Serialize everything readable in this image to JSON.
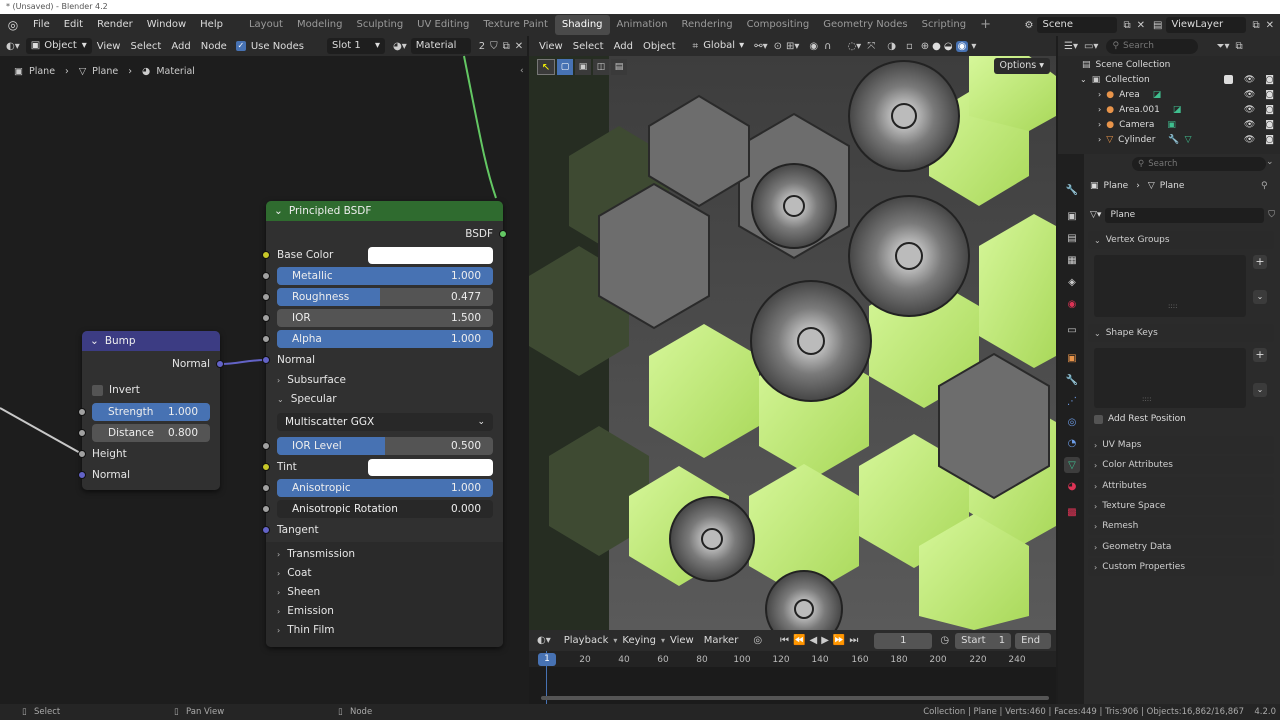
{
  "window_title": "* (Unsaved) - Blender 4.2",
  "menu": [
    "File",
    "Edit",
    "Render",
    "Window",
    "Help"
  ],
  "workspace_tabs": [
    {
      "label": "Layout",
      "active": false
    },
    {
      "label": "Modeling",
      "active": false
    },
    {
      "label": "Sculpting",
      "active": false
    },
    {
      "label": "UV Editing",
      "active": false
    },
    {
      "label": "Texture Paint",
      "active": false
    },
    {
      "label": "Shading",
      "active": true
    },
    {
      "label": "Animation",
      "active": false
    },
    {
      "label": "Rendering",
      "active": false
    },
    {
      "label": "Compositing",
      "active": false
    },
    {
      "label": "Geometry Nodes",
      "active": false
    },
    {
      "label": "Scripting",
      "active": false
    }
  ],
  "add_workspace": "+",
  "scene": {
    "label": "Scene",
    "view_layer": "ViewLayer"
  },
  "node_editor": {
    "mode": "Object",
    "menus": [
      "View",
      "Select",
      "Add",
      "Node"
    ],
    "use_nodes_label": "Use Nodes",
    "slot": "Slot 1",
    "material": "Material",
    "users": "2",
    "breadcrumb": [
      "Plane",
      "Plane",
      "Material"
    ]
  },
  "bump_node": {
    "title": "Bump",
    "output": "Normal",
    "invert_label": "Invert",
    "strength_label": "Strength",
    "strength_value": "1.000",
    "distance_label": "Distance",
    "distance_value": "0.800",
    "height_label": "Height",
    "normal_label": "Normal"
  },
  "bsdf_node": {
    "title": "Principled BSDF",
    "output": "BSDF",
    "base_color_label": "Base Color",
    "metallic": {
      "label": "Metallic",
      "value": "1.000",
      "fill": 1.0
    },
    "roughness": {
      "label": "Roughness",
      "value": "0.477",
      "fill": 0.477
    },
    "ior": {
      "label": "IOR",
      "value": "1.500"
    },
    "alpha": {
      "label": "Alpha",
      "value": "1.000",
      "fill": 1.0
    },
    "normal_label": "Normal",
    "subsurface_label": "Subsurface",
    "specular_label": "Specular",
    "distribution": "Multiscatter GGX",
    "ior_level": {
      "label": "IOR Level",
      "value": "0.500",
      "fill": 0.5
    },
    "tint_label": "Tint",
    "anisotropic": {
      "label": "Anisotropic",
      "value": "1.000",
      "fill": 1.0
    },
    "anisotropic_rotation": {
      "label": "Anisotropic Rotation",
      "value": "0.000"
    },
    "tangent_label": "Tangent",
    "panels": [
      "Transmission",
      "Coat",
      "Sheen",
      "Emission",
      "Thin Film"
    ]
  },
  "viewport": {
    "menus": [
      "View",
      "Select",
      "Add",
      "Object"
    ],
    "orientation": "Global",
    "options_label": "Options"
  },
  "outliner": {
    "search_placeholder": "Search",
    "root": "Scene Collection",
    "collection": "Collection",
    "items": [
      "Area",
      "Area.001",
      "Camera",
      "Cylinder"
    ]
  },
  "properties": {
    "search_placeholder": "Search",
    "breadcrumb": [
      "Plane",
      "Plane"
    ],
    "data_name": "Plane",
    "vertex_groups": "Vertex Groups",
    "shape_keys": "Shape Keys",
    "add_rest_position": "Add Rest Position",
    "collapsed_panels": [
      "UV Maps",
      "Color Attributes",
      "Attributes",
      "Texture Space",
      "Remesh",
      "Geometry Data",
      "Custom Properties"
    ]
  },
  "timeline": {
    "menus": [
      "Playback",
      "Keying",
      "View",
      "Marker"
    ],
    "current_frame": "1",
    "start_label": "Start",
    "start_value": "1",
    "end_label": "End",
    "ruler": [
      "1",
      "20",
      "40",
      "60",
      "80",
      "100",
      "120",
      "140",
      "160",
      "180",
      "200",
      "220",
      "240"
    ]
  },
  "status_bar": {
    "left": "Select",
    "middle": "Pan View",
    "right_hint": "Node",
    "stats": "Collection | Plane | Verts:460 | Faces:449 | Tris:906 | Objects:16,862/16,867",
    "version": "4.2.0"
  },
  "colors": {
    "accent_blue": "#4772b3",
    "bsdf_header": "#2f6b2f",
    "bump_header": "#3c3c83",
    "lime": "#c6f07a"
  }
}
